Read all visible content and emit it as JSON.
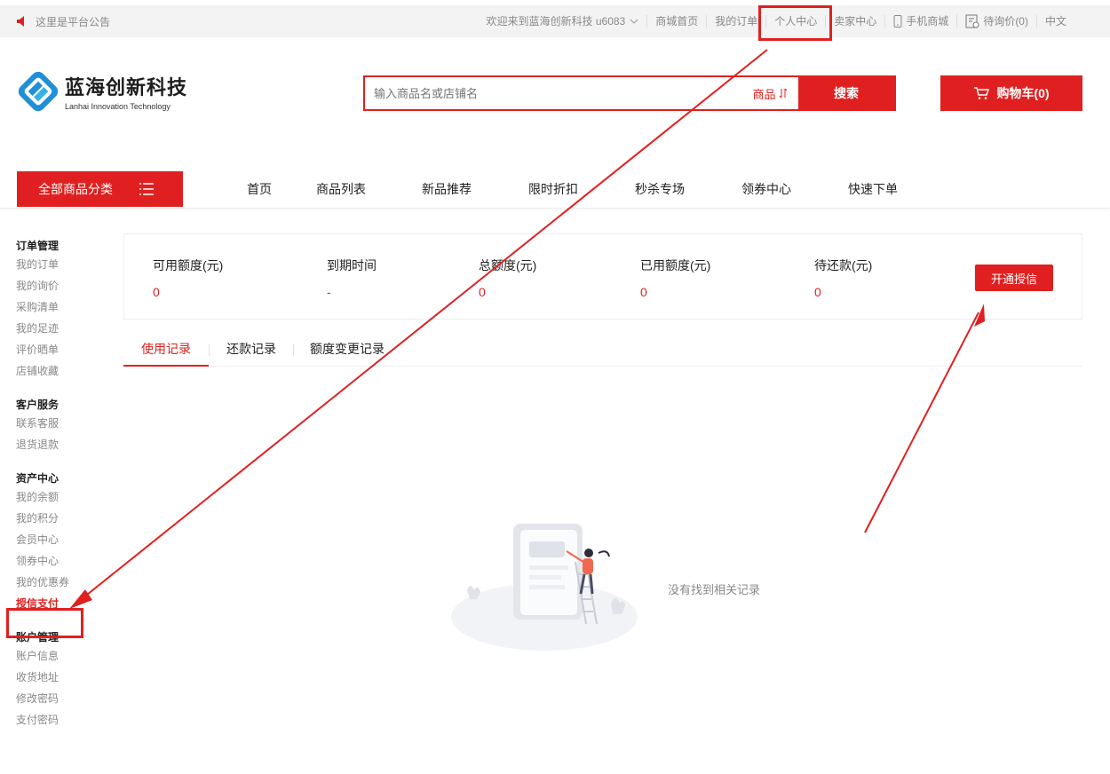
{
  "topbar": {
    "notice": "这里是平台公告",
    "welcome": "欢迎来到蓝海创新科技 u6083",
    "links": [
      "商城首页",
      "我的订单",
      "个人中心",
      "卖家中心",
      "手机商城",
      "待询价(0)",
      "中文"
    ]
  },
  "header": {
    "brand_cn": "蓝海创新科技",
    "brand_en": "Lanhai Innovation Technology",
    "search_placeholder": "输入商品名或店铺名",
    "search_scope": "商品",
    "search_button": "搜索",
    "cart_label": "购物车(0)"
  },
  "nav": {
    "all_categories": "全部商品分类",
    "items": [
      "首页",
      "商品列表",
      "新品推荐",
      "限时折扣",
      "秒杀专场",
      "领券中心",
      "快速下单"
    ]
  },
  "sidebar": {
    "groups": [
      {
        "title": "订单管理",
        "items": [
          "我的订单",
          "我的询价",
          "采购清单",
          "我的足迹",
          "评价晒单",
          "店铺收藏"
        ]
      },
      {
        "title": "客户服务",
        "items": [
          "联系客服",
          "退货退款"
        ]
      },
      {
        "title": "资产中心",
        "items": [
          "我的余额",
          "我的积分",
          "会员中心",
          "领券中心",
          "我的优惠券",
          "授信支付"
        ]
      },
      {
        "title": "账户管理",
        "items": [
          "账户信息",
          "收货地址",
          "修改密码",
          "支付密码"
        ]
      }
    ],
    "active": "授信支付"
  },
  "summary": {
    "stats": [
      {
        "label": "可用额度(元)",
        "value": "0"
      },
      {
        "label": "到期时间",
        "value": "-"
      },
      {
        "label": "总额度(元)",
        "value": "0"
      },
      {
        "label": "已用额度(元)",
        "value": "0"
      },
      {
        "label": "待还款(元)",
        "value": "0"
      }
    ],
    "open_button": "开通授信"
  },
  "tabs": [
    "使用记录",
    "还款记录",
    "额度变更记录"
  ],
  "empty_text": "没有找到相关记录",
  "colors": {
    "accent": "#e02020",
    "annotation": "#e02020"
  }
}
